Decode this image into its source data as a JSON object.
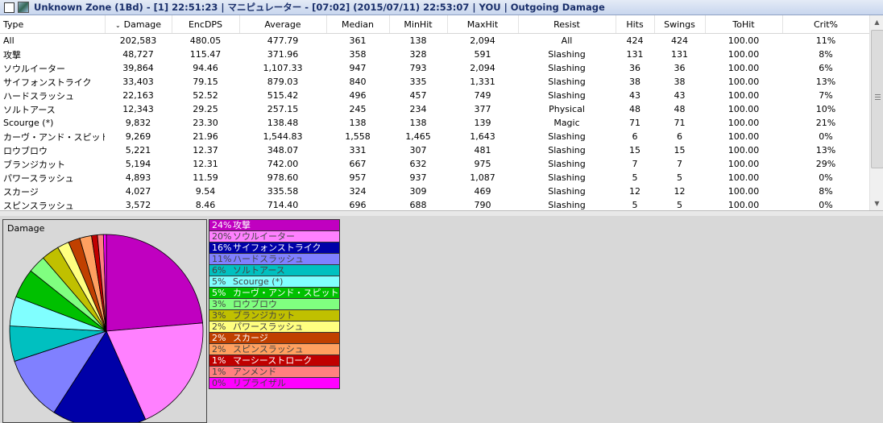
{
  "window": {
    "title": "Unknown Zone (1Bd) - [1] 22:51:23 | マニピュレーター - [07:02] (2015/07/11) 22:53:07 | YOU | Outgoing Damage"
  },
  "table": {
    "columns": [
      "Type",
      "Damage",
      "EncDPS",
      "Average",
      "Median",
      "MinHit",
      "MaxHit",
      "Resist",
      "Hits",
      "Swings",
      "ToHit",
      "Crit%"
    ],
    "sort_indicator": "⌄",
    "rows": [
      [
        "All",
        "202,583",
        "480.05",
        "477.79",
        "361",
        "138",
        "2,094",
        "All",
        "424",
        "424",
        "100.00",
        "11%"
      ],
      [
        "攻撃",
        "48,727",
        "115.47",
        "371.96",
        "358",
        "328",
        "591",
        "Slashing",
        "131",
        "131",
        "100.00",
        "8%"
      ],
      [
        "ソウルイーター",
        "39,864",
        "94.46",
        "1,107.33",
        "947",
        "793",
        "2,094",
        "Slashing",
        "36",
        "36",
        "100.00",
        "6%"
      ],
      [
        "サイフォンストライク",
        "33,403",
        "79.15",
        "879.03",
        "840",
        "335",
        "1,331",
        "Slashing",
        "38",
        "38",
        "100.00",
        "13%"
      ],
      [
        "ハードスラッシュ",
        "22,163",
        "52.52",
        "515.42",
        "496",
        "457",
        "749",
        "Slashing",
        "43",
        "43",
        "100.00",
        "7%"
      ],
      [
        "ソルトアース",
        "12,343",
        "29.25",
        "257.15",
        "245",
        "234",
        "377",
        "Physical",
        "48",
        "48",
        "100.00",
        "10%"
      ],
      [
        "Scourge (*)",
        "9,832",
        "23.30",
        "138.48",
        "138",
        "138",
        "139",
        "Magic",
        "71",
        "71",
        "100.00",
        "21%"
      ],
      [
        "カーヴ・アンド・スピット",
        "9,269",
        "21.96",
        "1,544.83",
        "1,558",
        "1,465",
        "1,643",
        "Slashing",
        "6",
        "6",
        "100.00",
        "0%"
      ],
      [
        "ロウブロウ",
        "5,221",
        "12.37",
        "348.07",
        "331",
        "307",
        "481",
        "Slashing",
        "15",
        "15",
        "100.00",
        "13%"
      ],
      [
        "ブランジカット",
        "5,194",
        "12.31",
        "742.00",
        "667",
        "632",
        "975",
        "Slashing",
        "7",
        "7",
        "100.00",
        "29%"
      ],
      [
        "パワースラッシュ",
        "4,893",
        "11.59",
        "978.60",
        "957",
        "937",
        "1,087",
        "Slashing",
        "5",
        "5",
        "100.00",
        "0%"
      ],
      [
        "スカージ",
        "4,027",
        "9.54",
        "335.58",
        "324",
        "309",
        "469",
        "Slashing",
        "12",
        "12",
        "100.00",
        "8%"
      ],
      [
        "スピンスラッシュ",
        "3,572",
        "8.46",
        "714.40",
        "696",
        "688",
        "790",
        "Slashing",
        "5",
        "5",
        "100.00",
        "0%"
      ]
    ]
  },
  "scrollbar": {
    "up_arrow": "▲",
    "down_arrow": "▼"
  },
  "pie": {
    "title": "Damage",
    "slices": [
      {
        "label": "攻撃",
        "pct": "24%",
        "value": 24,
        "color": "#c000c0"
      },
      {
        "label": "ソウルイーター",
        "pct": "20%",
        "value": 20,
        "color": "#ff80ff"
      },
      {
        "label": "サイフォンストライク",
        "pct": "16%",
        "value": 16,
        "color": "#0000a8"
      },
      {
        "label": "ハードスラッシュ",
        "pct": "11%",
        "value": 11,
        "color": "#8080ff"
      },
      {
        "label": "ソルトアース",
        "pct": "6%",
        "value": 6,
        "color": "#00c0c0"
      },
      {
        "label": "Scourge (*)",
        "pct": "5%",
        "value": 5,
        "color": "#80ffff"
      },
      {
        "label": "カーヴ・アンド・スピット",
        "pct": "5%",
        "value": 5,
        "color": "#00c000"
      },
      {
        "label": "ロウブロウ",
        "pct": "3%",
        "value": 3,
        "color": "#80ff80"
      },
      {
        "label": "ブランジカット",
        "pct": "3%",
        "value": 3,
        "color": "#c0c000"
      },
      {
        "label": "パワースラッシュ",
        "pct": "2%",
        "value": 2,
        "color": "#ffff80"
      },
      {
        "label": "スカージ",
        "pct": "2%",
        "value": 2,
        "color": "#c04000"
      },
      {
        "label": "スピンスラッシュ",
        "pct": "2%",
        "value": 2,
        "color": "#ffa060"
      },
      {
        "label": "マーシーストローク",
        "pct": "1%",
        "value": 1,
        "color": "#c00000"
      },
      {
        "label": "アンメンド",
        "pct": "1%",
        "value": 1,
        "color": "#ff8080"
      },
      {
        "label": "リプライザル",
        "pct": "0%",
        "value": 0.5,
        "color": "#ff00ff"
      }
    ]
  }
}
